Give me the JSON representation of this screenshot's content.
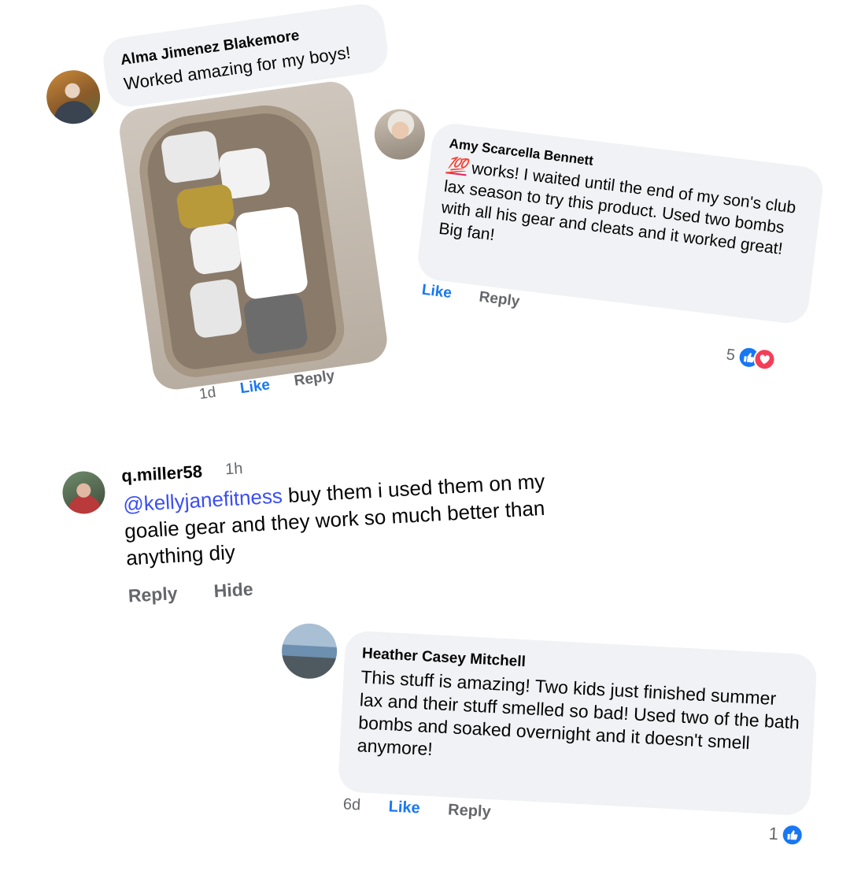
{
  "comments": [
    {
      "author": "Alma Jimenez Blakemore",
      "text": "Worked amazing for my boys!",
      "time": "1d",
      "like_label": "Like",
      "reply_label": "Reply",
      "photo": "lacrosse-gear-in-bathtub"
    },
    {
      "author": "Amy Scarcella Bennett",
      "emoji": "💯",
      "text": " works! I waited until the end of my son's club lax season to try this product. Used two bombs with all his gear and cleats and it worked great! Big fan!",
      "like_label": "Like",
      "reply_label": "Reply",
      "reaction_count": "5",
      "reactions": [
        "like-icon",
        "love-icon"
      ]
    },
    {
      "author": "q.miller58",
      "time": "1h",
      "mention": "@kellyjanefitness",
      "text": " buy them i used them on my goalie gear and they work so much better than anything diy",
      "reply_label": "Reply",
      "hide_label": "Hide"
    },
    {
      "author": "Heather Casey Mitchell",
      "text": "This stuff is amazing! Two kids just finished summer lax and their stuff smelled so bad! Used two of the bath bombs and soaked overnight and it doesn't smell anymore!",
      "time": "6d",
      "like_label": "Like",
      "reply_label": "Reply",
      "reaction_count": "1",
      "reactions": [
        "like-icon"
      ]
    }
  ],
  "colors": {
    "bubble": "#f0f2f5",
    "like": "#1877f2",
    "muted": "#65676b",
    "mention": "#3a4ff0",
    "love": "#f33e58"
  }
}
